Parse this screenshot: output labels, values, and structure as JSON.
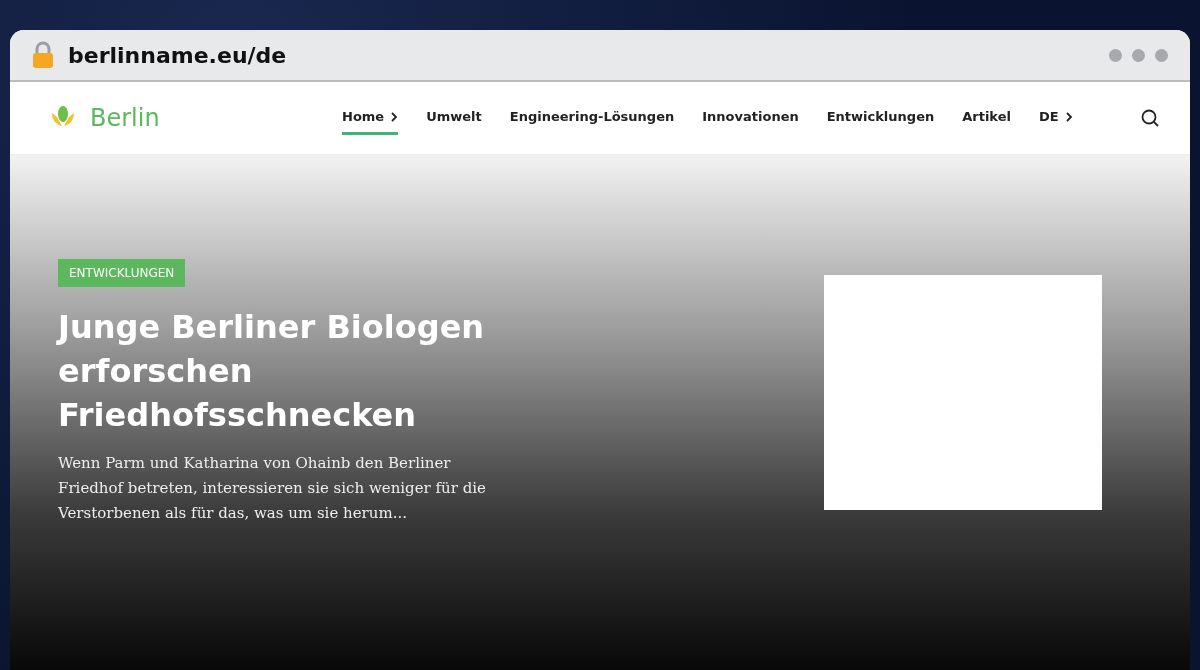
{
  "browser": {
    "url": "berlinname.eu/de"
  },
  "site": {
    "name": "Berlin"
  },
  "nav": [
    {
      "label": "Home",
      "selected": true,
      "has_submenu": true
    },
    {
      "label": "Umwelt",
      "selected": false,
      "has_submenu": false
    },
    {
      "label": "Engineering-Lösungen",
      "selected": false,
      "has_submenu": false
    },
    {
      "label": "Innovationen",
      "selected": false,
      "has_submenu": false
    },
    {
      "label": "Entwicklungen",
      "selected": false,
      "has_submenu": false
    },
    {
      "label": "Artikel",
      "selected": false,
      "has_submenu": false
    },
    {
      "label": "DE",
      "selected": false,
      "has_submenu": true
    }
  ],
  "hero": {
    "category": "ENTWICKLUNGEN",
    "title": "Junge Berliner Biologen erforschen Friedhofsschnecken",
    "excerpt": "Wenn Parm und Katharina von Ohainb den Berliner Friedhof betreten, interessieren sie sich weniger für die Verstorbenen als für das, was um sie herum..."
  }
}
